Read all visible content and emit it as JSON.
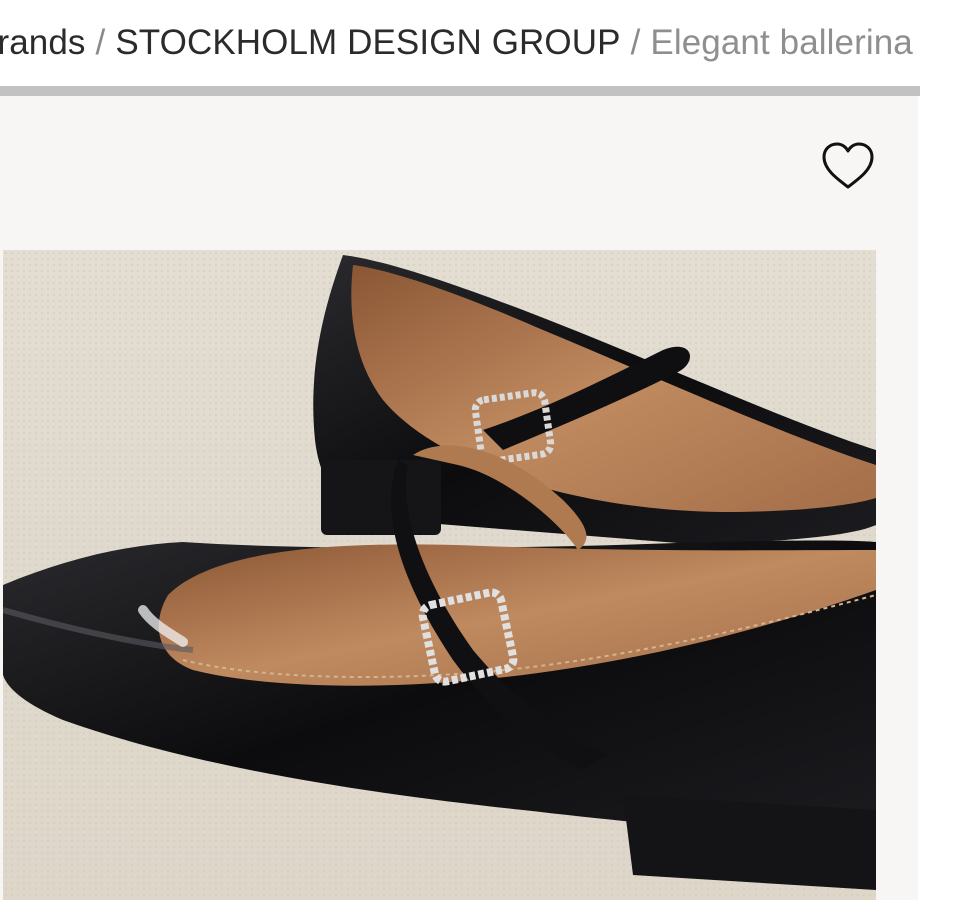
{
  "breadcrumb": {
    "items": [
      {
        "label": "Brands"
      },
      {
        "label": "STOCKHOLM DESIGN GROUP"
      }
    ],
    "separator": "/",
    "current": "Elegant ballerina"
  },
  "wishlist": {
    "icon": "heart-outline-icon"
  },
  "colors": {
    "divider": "#c2c2c2",
    "gallery_background": "#f8f6f4",
    "breadcrumb_link": "#2b2b2b",
    "breadcrumb_current": "#8f8f8f"
  }
}
